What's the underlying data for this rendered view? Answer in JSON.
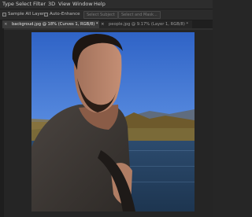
{
  "menu": {
    "items": [
      "Type",
      "Select",
      "Filter",
      "3D",
      "View",
      "Window",
      "Help"
    ]
  },
  "options": {
    "sample_all_layers": "Sample All Layers",
    "auto_enhance": "Auto-Enhance",
    "select_subject": "Select Subject",
    "select_and_mask": "Select and Mask..."
  },
  "tabs": [
    {
      "label": "backgroud.jpg @ 18% (Curves 1, RGB/8) *",
      "active": true
    },
    {
      "label": "people.jpg @ 9.17% (Layer 1, RGB/8) *",
      "active": false
    }
  ],
  "tab_close_glyph": "×"
}
